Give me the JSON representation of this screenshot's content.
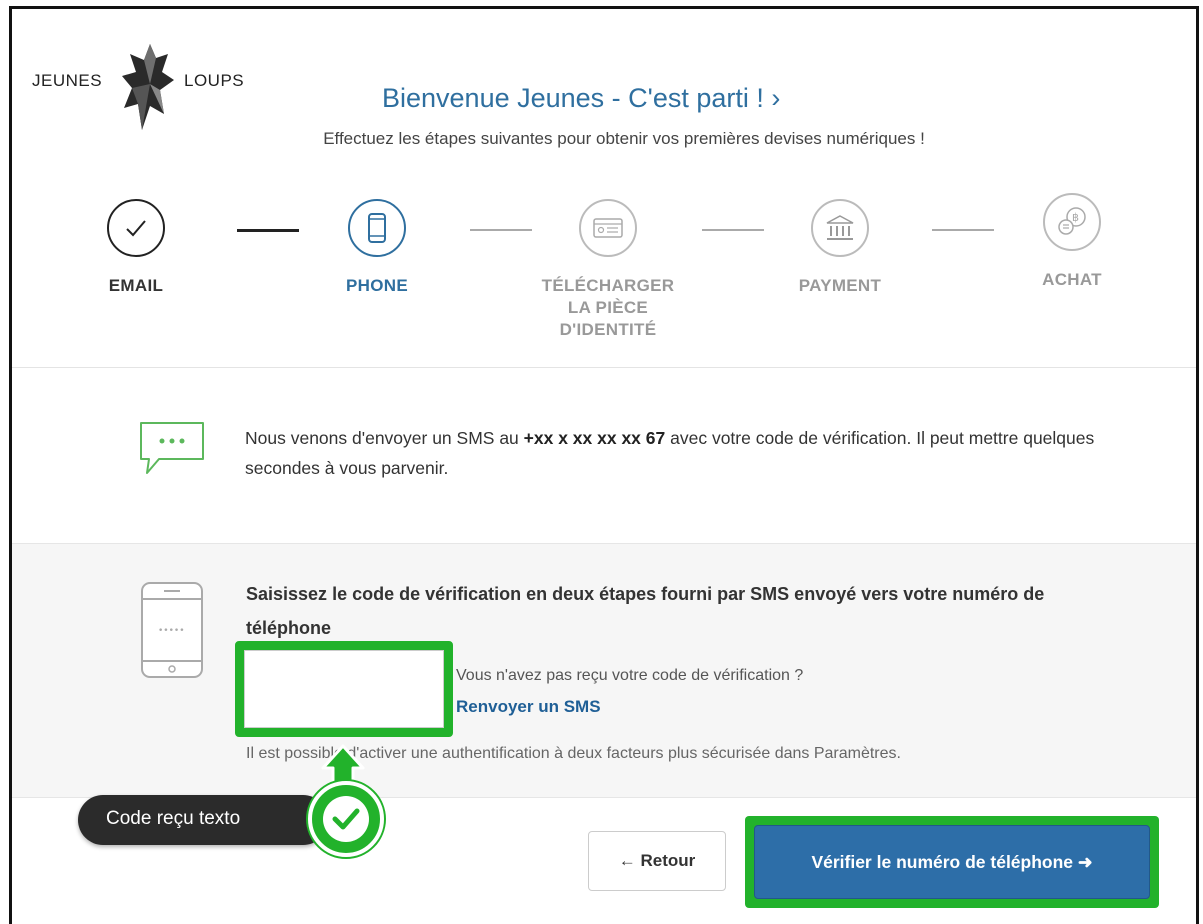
{
  "brand": {
    "word1": "JEUNES",
    "word2": "LOUPS"
  },
  "header": {
    "title": "Bienvenue Jeunes - C'est parti ! ›",
    "subtitle": "Effectuez les étapes suivantes pour obtenir vos premières devises numériques !"
  },
  "steps": [
    {
      "label": "EMAIL",
      "state": "done",
      "icon": "check-icon"
    },
    {
      "label": "PHONE",
      "state": "active",
      "icon": "phone-icon"
    },
    {
      "label": "TÉLÉCHARGER LA PIÈCE D'IDENTITÉ",
      "state": "pending",
      "icon": "id-card-icon"
    },
    {
      "label": "PAYMENT",
      "state": "pending",
      "icon": "bank-icon"
    },
    {
      "label": "ACHAT",
      "state": "pending",
      "icon": "coins-icon"
    }
  ],
  "sms": {
    "text_before": "Nous venons d'envoyer un SMS au ",
    "number": "+xx x xx xx xx 67",
    "text_after": " avec votre code de vérification. Il peut mettre quelques secondes à vous parvenir."
  },
  "verification": {
    "title": "Saisissez le code de vérification en deux étapes fourni par SMS envoyé vers votre numéro de téléphone",
    "input_value": "",
    "resend_question": "Vous n'avez pas reçu votre code de vérification ?",
    "resend_link": "Renvoyer un SMS",
    "twofa_note": "Il est possible d'activer une authentification à deux facteurs plus sécurisée dans Paramètres."
  },
  "callout": {
    "label": "Code reçu texto"
  },
  "actions": {
    "back_label": "← Retour",
    "verify_label": "Vérifier le numéro de téléphone ➜"
  },
  "colors": {
    "accent": "#2f6f9f",
    "highlight_green": "#22b22b",
    "button_blue": "#2d6ea8"
  }
}
